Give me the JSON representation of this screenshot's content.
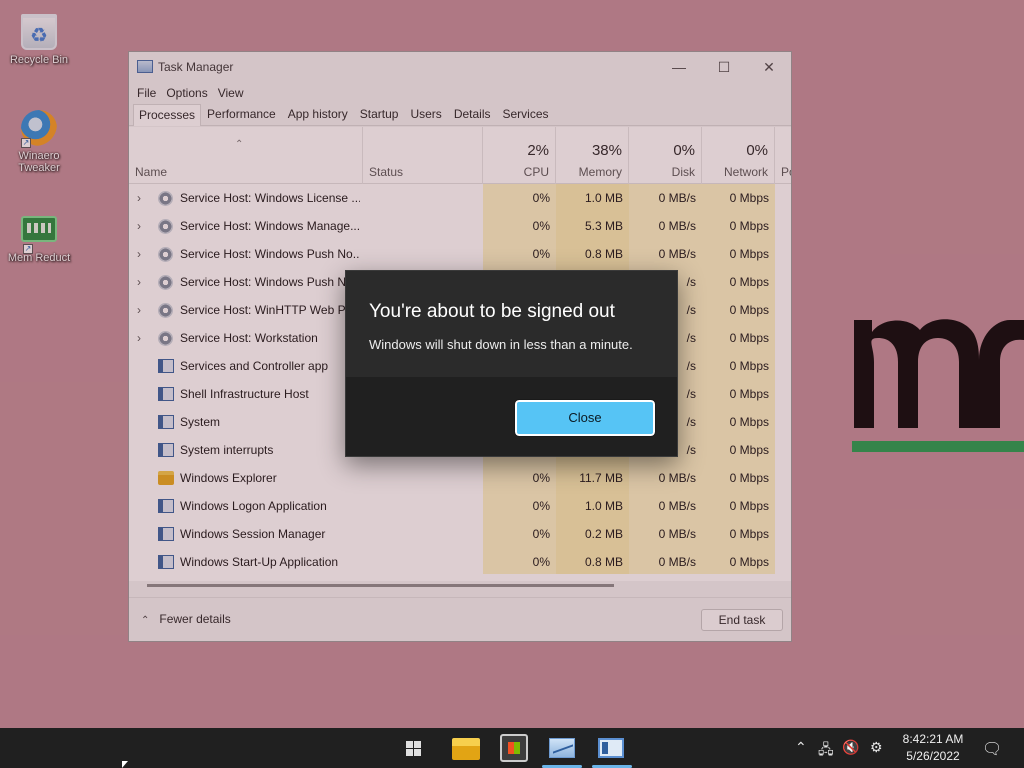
{
  "desktop": {
    "icons": [
      {
        "label": "Recycle Bin"
      },
      {
        "label": "Winaero Tweaker"
      },
      {
        "label": "Mem Reduct"
      }
    ]
  },
  "task_manager": {
    "title": "Task Manager",
    "menu": [
      "File",
      "Options",
      "View"
    ],
    "tabs": [
      "Processes",
      "Performance",
      "App history",
      "Startup",
      "Users",
      "Details",
      "Services"
    ],
    "active_tab": "Processes",
    "columns": {
      "name": "Name",
      "status": "Status",
      "cpu": {
        "pct": "2%",
        "label": "CPU"
      },
      "memory": {
        "pct": "38%",
        "label": "Memory"
      },
      "disk": {
        "pct": "0%",
        "label": "Disk"
      },
      "network": {
        "pct": "0%",
        "label": "Network"
      },
      "power": "Po"
    },
    "rows": [
      {
        "name": "Service Host: Windows License ...",
        "cpu": "0%",
        "memory": "1.0 MB",
        "disk": "0 MB/s",
        "network": "0 Mbps"
      },
      {
        "name": "Service Host: Windows Manage...",
        "cpu": "0%",
        "memory": "5.3 MB",
        "disk": "0 MB/s",
        "network": "0 Mbps"
      },
      {
        "name": "Service Host: Windows Push No...",
        "cpu": "0%",
        "memory": "0.8 MB",
        "disk": "0 MB/s",
        "network": "0 Mbps"
      },
      {
        "name": "Service Host: Windows Push No",
        "cpu": "",
        "memory": "",
        "disk": "/s",
        "network": "0 Mbps"
      },
      {
        "name": "Service Host: WinHTTP Web Pro",
        "cpu": "",
        "memory": "",
        "disk": "/s",
        "network": "0 Mbps"
      },
      {
        "name": "Service Host: Workstation",
        "cpu": "",
        "memory": "",
        "disk": "/s",
        "network": "0 Mbps"
      },
      {
        "name": "Services and Controller app",
        "cpu": "",
        "memory": "",
        "disk": "/s",
        "network": "0 Mbps"
      },
      {
        "name": "Shell Infrastructure Host",
        "cpu": "",
        "memory": "",
        "disk": "/s",
        "network": "0 Mbps"
      },
      {
        "name": "System",
        "cpu": "",
        "memory": "",
        "disk": "/s",
        "network": "0 Mbps"
      },
      {
        "name": "System interrupts",
        "cpu": "",
        "memory": "",
        "disk": "/s",
        "network": "0 Mbps"
      },
      {
        "name": "Windows Explorer",
        "cpu": "0%",
        "memory": "11.7 MB",
        "disk": "0 MB/s",
        "network": "0 Mbps"
      },
      {
        "name": "Windows Logon Application",
        "cpu": "0%",
        "memory": "1.0 MB",
        "disk": "0 MB/s",
        "network": "0 Mbps"
      },
      {
        "name": "Windows Session Manager",
        "cpu": "0%",
        "memory": "0.2 MB",
        "disk": "0 MB/s",
        "network": "0 Mbps"
      },
      {
        "name": "Windows Start-Up Application",
        "cpu": "0%",
        "memory": "0.8 MB",
        "disk": "0 MB/s",
        "network": "0 Mbps"
      }
    ],
    "fewer_details": "Fewer details",
    "end_task": "End task"
  },
  "dialog": {
    "title": "You're about to be signed out",
    "message": "Windows will shut down in less than a minute.",
    "close_label": "Close"
  },
  "taskbar": {
    "time": "8:42:21 AM",
    "date": "5/26/2022"
  },
  "colors": {
    "desktop_bg": "#c28d98",
    "dialog_bg": "#2b2b2b",
    "close_button": "#56c4f5",
    "logo_bar": "#1f9c4b"
  }
}
